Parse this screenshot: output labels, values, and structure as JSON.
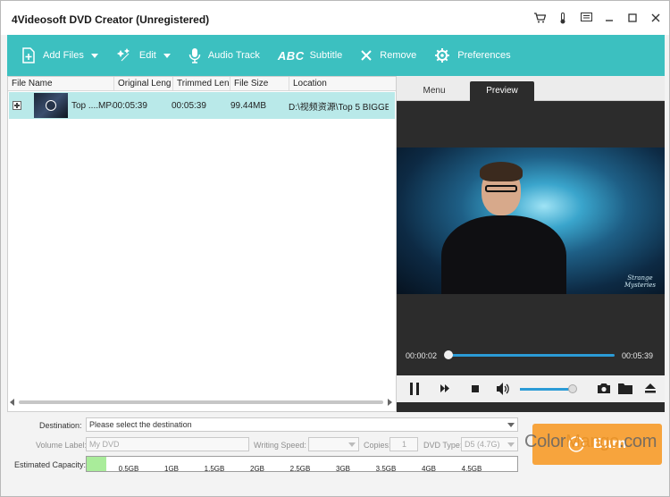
{
  "window": {
    "title": "4Videosoft DVD Creator (Unregistered)"
  },
  "titlebar_icons": [
    "cart-icon",
    "thermometer-icon",
    "feedback-icon",
    "minimize-icon",
    "maximize-icon",
    "close-icon"
  ],
  "toolbar": {
    "add_files": "Add Files",
    "edit": "Edit",
    "audio_track": "Audio Track",
    "subtitle_abc": "ABC",
    "subtitle": "Subtitle",
    "remove": "Remove",
    "preferences": "Preferences"
  },
  "filelist": {
    "columns": [
      "File Name",
      "Original Leng",
      "Trimmed Len",
      "File Size",
      "Location"
    ],
    "rows": [
      {
        "name": "Top ....MP4",
        "original": "00:05:39",
        "trimmed": "00:05:39",
        "size": "99.44MB",
        "location": "D:\\视频资源\\Top 5 BIGGES..."
      }
    ]
  },
  "preview": {
    "tabs": [
      "Menu",
      "Preview"
    ],
    "active_tab": "Preview",
    "logo_text_line1": "Strange",
    "logo_text_line2": "Mysteries",
    "current_time": "00:00:02",
    "total_time": "00:05:39",
    "progress_fraction": 0.006,
    "volume_fraction": 1.0
  },
  "bottom": {
    "destination_label": "Destination:",
    "destination_value": "Please select the destination",
    "volume_label": "Volume Label:",
    "volume_value": "My DVD",
    "writing_speed_label": "Writing Speed:",
    "copies_label": "Copies:",
    "copies_value": "1",
    "dvd_type_label": "DVD Type:",
    "dvd_type_value": "D5 (4.7G)",
    "capacity_label": "Estimated Capacity:",
    "capacity_ticks": [
      "0.5GB",
      "1GB",
      "1.5GB",
      "2GB",
      "2.5GB",
      "3GB",
      "3.5GB",
      "4GB",
      "4.5GB"
    ],
    "capacity_used_gb": 0.1
  },
  "burn": {
    "label": "Burn"
  },
  "watermark": {
    "part1": "Color",
    "part2": "Mango",
    "part3": ".com"
  },
  "colors": {
    "toolbar": "#3cc0c0",
    "selected_row": "#b9e9e9",
    "burn": "#f7a43d",
    "accent_blue": "#2b9bd6",
    "capacity_fill": "#a9ec9a"
  }
}
